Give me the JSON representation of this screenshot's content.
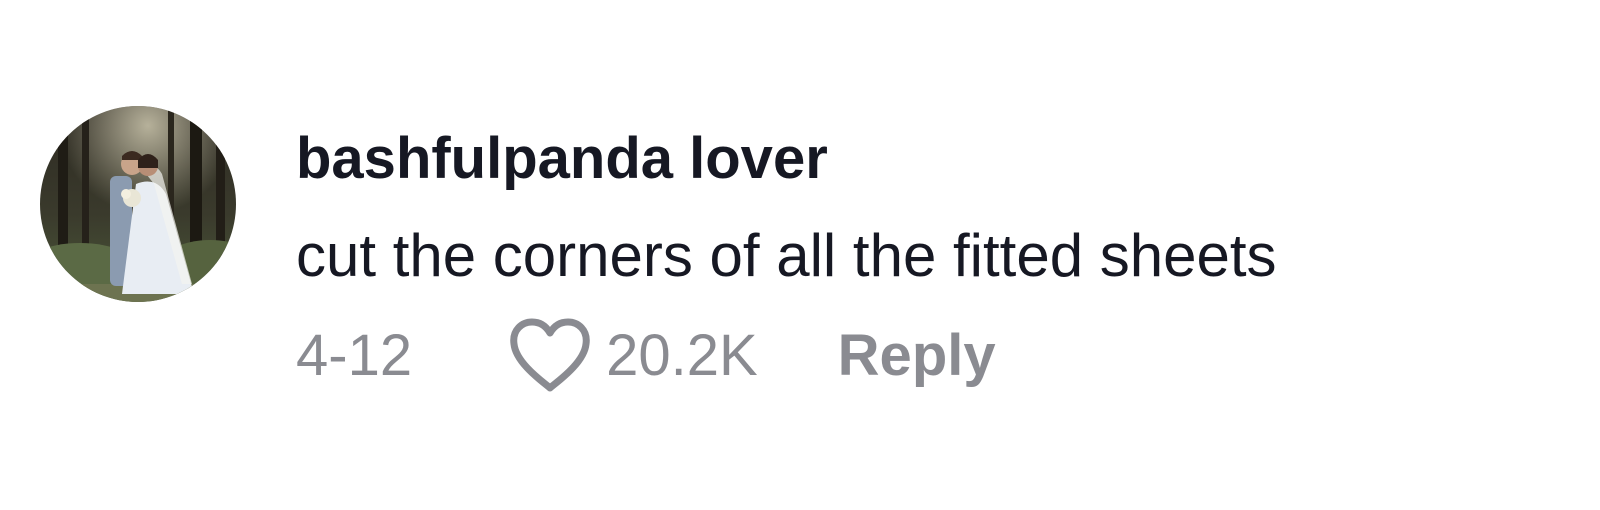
{
  "comment": {
    "avatar": {
      "icon": "user-avatar-photo"
    },
    "username": "bashfulpanda lover",
    "text": "cut the corners of all the fitted sheets",
    "date": "4-12",
    "like": {
      "icon": "heart-outline-icon",
      "count": "20.2K"
    },
    "reply_label": "Reply"
  },
  "colors": {
    "primary_text": "#161823",
    "secondary_text": "#8a8b91",
    "background": "#ffffff"
  }
}
